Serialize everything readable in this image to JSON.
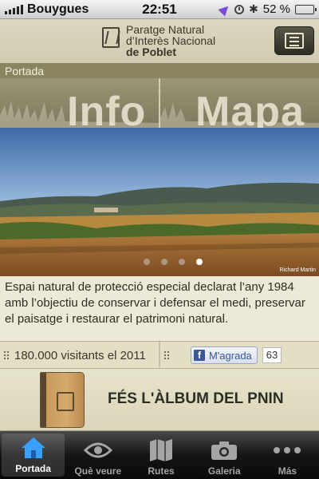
{
  "status_bar": {
    "carrier": "Bouygues",
    "time": "22:51",
    "battery": "52 %",
    "battery_level": 0.52
  },
  "header": {
    "line1": "Paratge Natural",
    "line2": "d’Interès Nacional",
    "line3": "de Poblet"
  },
  "section": {
    "title": "Portada"
  },
  "banner": {
    "left": "Info",
    "right": "Mapa"
  },
  "slideshow": {
    "page_count": 4,
    "active_page": 4,
    "credit": "Richard Martin"
  },
  "description": "Espai natural de protecció especial declarat l’any 1984 amb l’objectiu de conservar i defensar el medi, preservar el paisatge i restaurar el patrimoni natural.",
  "stats": {
    "visitors": "180.000 visitants el 2011",
    "like_label": "M'agrada",
    "like_count": "63"
  },
  "album": {
    "title": "FÉS L'ÀLBUM DEL PNIN"
  },
  "tabs": [
    {
      "label": "Portada",
      "icon": "home-icon"
    },
    {
      "label": "Què veure",
      "icon": "eye-icon"
    },
    {
      "label": "Rutes",
      "icon": "map-icon"
    },
    {
      "label": "Galeria",
      "icon": "camera-icon"
    },
    {
      "label": "Más",
      "icon": "more-dots-icon"
    }
  ]
}
